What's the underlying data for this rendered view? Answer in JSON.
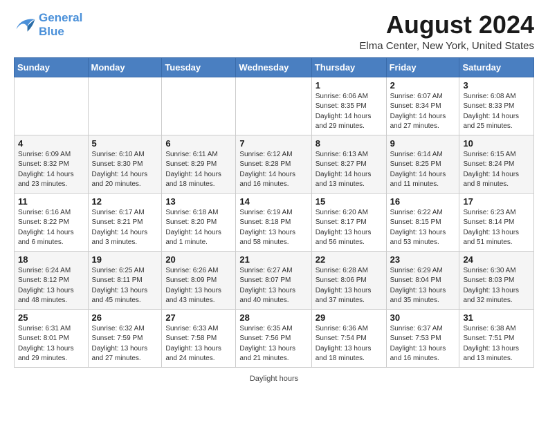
{
  "header": {
    "logo_line1": "General",
    "logo_line2": "Blue",
    "month_title": "August 2024",
    "location": "Elma Center, New York, United States"
  },
  "days_of_week": [
    "Sunday",
    "Monday",
    "Tuesday",
    "Wednesday",
    "Thursday",
    "Friday",
    "Saturday"
  ],
  "weeks": [
    [
      {
        "day": "",
        "info": ""
      },
      {
        "day": "",
        "info": ""
      },
      {
        "day": "",
        "info": ""
      },
      {
        "day": "",
        "info": ""
      },
      {
        "day": "1",
        "info": "Sunrise: 6:06 AM\nSunset: 8:35 PM\nDaylight: 14 hours and 29 minutes."
      },
      {
        "day": "2",
        "info": "Sunrise: 6:07 AM\nSunset: 8:34 PM\nDaylight: 14 hours and 27 minutes."
      },
      {
        "day": "3",
        "info": "Sunrise: 6:08 AM\nSunset: 8:33 PM\nDaylight: 14 hours and 25 minutes."
      }
    ],
    [
      {
        "day": "4",
        "info": "Sunrise: 6:09 AM\nSunset: 8:32 PM\nDaylight: 14 hours and 23 minutes."
      },
      {
        "day": "5",
        "info": "Sunrise: 6:10 AM\nSunset: 8:30 PM\nDaylight: 14 hours and 20 minutes."
      },
      {
        "day": "6",
        "info": "Sunrise: 6:11 AM\nSunset: 8:29 PM\nDaylight: 14 hours and 18 minutes."
      },
      {
        "day": "7",
        "info": "Sunrise: 6:12 AM\nSunset: 8:28 PM\nDaylight: 14 hours and 16 minutes."
      },
      {
        "day": "8",
        "info": "Sunrise: 6:13 AM\nSunset: 8:27 PM\nDaylight: 14 hours and 13 minutes."
      },
      {
        "day": "9",
        "info": "Sunrise: 6:14 AM\nSunset: 8:25 PM\nDaylight: 14 hours and 11 minutes."
      },
      {
        "day": "10",
        "info": "Sunrise: 6:15 AM\nSunset: 8:24 PM\nDaylight: 14 hours and 8 minutes."
      }
    ],
    [
      {
        "day": "11",
        "info": "Sunrise: 6:16 AM\nSunset: 8:22 PM\nDaylight: 14 hours and 6 minutes."
      },
      {
        "day": "12",
        "info": "Sunrise: 6:17 AM\nSunset: 8:21 PM\nDaylight: 14 hours and 3 minutes."
      },
      {
        "day": "13",
        "info": "Sunrise: 6:18 AM\nSunset: 8:20 PM\nDaylight: 14 hours and 1 minute."
      },
      {
        "day": "14",
        "info": "Sunrise: 6:19 AM\nSunset: 8:18 PM\nDaylight: 13 hours and 58 minutes."
      },
      {
        "day": "15",
        "info": "Sunrise: 6:20 AM\nSunset: 8:17 PM\nDaylight: 13 hours and 56 minutes."
      },
      {
        "day": "16",
        "info": "Sunrise: 6:22 AM\nSunset: 8:15 PM\nDaylight: 13 hours and 53 minutes."
      },
      {
        "day": "17",
        "info": "Sunrise: 6:23 AM\nSunset: 8:14 PM\nDaylight: 13 hours and 51 minutes."
      }
    ],
    [
      {
        "day": "18",
        "info": "Sunrise: 6:24 AM\nSunset: 8:12 PM\nDaylight: 13 hours and 48 minutes."
      },
      {
        "day": "19",
        "info": "Sunrise: 6:25 AM\nSunset: 8:11 PM\nDaylight: 13 hours and 45 minutes."
      },
      {
        "day": "20",
        "info": "Sunrise: 6:26 AM\nSunset: 8:09 PM\nDaylight: 13 hours and 43 minutes."
      },
      {
        "day": "21",
        "info": "Sunrise: 6:27 AM\nSunset: 8:07 PM\nDaylight: 13 hours and 40 minutes."
      },
      {
        "day": "22",
        "info": "Sunrise: 6:28 AM\nSunset: 8:06 PM\nDaylight: 13 hours and 37 minutes."
      },
      {
        "day": "23",
        "info": "Sunrise: 6:29 AM\nSunset: 8:04 PM\nDaylight: 13 hours and 35 minutes."
      },
      {
        "day": "24",
        "info": "Sunrise: 6:30 AM\nSunset: 8:03 PM\nDaylight: 13 hours and 32 minutes."
      }
    ],
    [
      {
        "day": "25",
        "info": "Sunrise: 6:31 AM\nSunset: 8:01 PM\nDaylight: 13 hours and 29 minutes."
      },
      {
        "day": "26",
        "info": "Sunrise: 6:32 AM\nSunset: 7:59 PM\nDaylight: 13 hours and 27 minutes."
      },
      {
        "day": "27",
        "info": "Sunrise: 6:33 AM\nSunset: 7:58 PM\nDaylight: 13 hours and 24 minutes."
      },
      {
        "day": "28",
        "info": "Sunrise: 6:35 AM\nSunset: 7:56 PM\nDaylight: 13 hours and 21 minutes."
      },
      {
        "day": "29",
        "info": "Sunrise: 6:36 AM\nSunset: 7:54 PM\nDaylight: 13 hours and 18 minutes."
      },
      {
        "day": "30",
        "info": "Sunrise: 6:37 AM\nSunset: 7:53 PM\nDaylight: 13 hours and 16 minutes."
      },
      {
        "day": "31",
        "info": "Sunrise: 6:38 AM\nSunset: 7:51 PM\nDaylight: 13 hours and 13 minutes."
      }
    ]
  ],
  "footer": {
    "daylight_label": "Daylight hours"
  }
}
